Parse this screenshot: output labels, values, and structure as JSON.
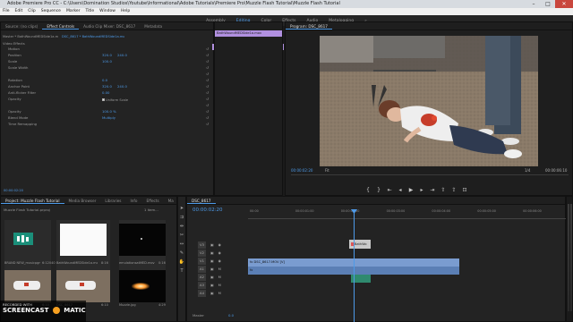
{
  "window": {
    "title": "Adobe Premiere Pro CC - C:\\Users\\Domination Studios\\Youtube\\Informational\\Adobe Tutorials\\Premiere Pro\\Muzzle Flash Tutorial\\Muzzle Flash Tutorial",
    "minimize": "–",
    "maximize": "□",
    "close": "✕"
  },
  "menu": [
    "File",
    "Edit",
    "Clip",
    "Sequence",
    "Marker",
    "Title",
    "Window",
    "Help"
  ],
  "workspaces": {
    "items": [
      "Assembly",
      "Editing",
      "Color",
      "Effects",
      "Audio",
      "Metalogging"
    ],
    "active": "Editing",
    "overflow": "»"
  },
  "effect_controls": {
    "tabs": [
      "Source: (no clips)",
      "Effect Controls",
      "Audio Clip Mixer: DSC_8617",
      "Metadata"
    ],
    "active_tab": "Effect Controls",
    "master_label": "Master * BathWoundMEDSide1a.mov",
    "clip_label": "DSC_8617 * BathWoundMEDSide1a.mov",
    "section_video_effects": "Video Effects",
    "clip_name_in_mini_timeline": "BathWoundMEDSide1a.mov",
    "rows": [
      {
        "label": "Motion",
        "v1": "",
        "v2": ""
      },
      {
        "label": "Position",
        "v1": "320.0",
        "v2": "240.0"
      },
      {
        "label": "Scale",
        "v1": "100.0",
        "v2": ""
      },
      {
        "label": "Scale Width",
        "v1": "",
        "v2": ""
      },
      {
        "label": "",
        "v1": "",
        "v2": ""
      },
      {
        "label": "Rotation",
        "v1": "0.0",
        "v2": ""
      },
      {
        "label": "Anchor Point",
        "v1": "320.0",
        "v2": "240.0"
      },
      {
        "label": "Anti-flicker Filter",
        "v1": "0.00",
        "v2": ""
      },
      {
        "label": "Opacity",
        "v1": "",
        "v2": ""
      },
      {
        "label": "",
        "v1": "",
        "v2": ""
      },
      {
        "label": "Opacity",
        "v1": "100.0 %",
        "v2": ""
      },
      {
        "label": "Blend Mode",
        "v1": "Multiply",
        "v2": ""
      },
      {
        "label": "Time Remapping",
        "v1": "",
        "v2": ""
      }
    ],
    "uniform_scale": "Uniform Scale",
    "timecode": "00:00:02:20"
  },
  "program_monitor": {
    "title": "Program: DSC_8617",
    "timecode": "00:00:02:20",
    "fit": "Fit",
    "page": "1/4",
    "duration": "00:00:06:10"
  },
  "project": {
    "tabs": [
      "Project: Muzzle Flash Tutorial",
      "Media Browser",
      "Libraries",
      "Info",
      "Effects",
      "Ma"
    ],
    "active_tab": "Project: Muzzle Flash Tutorial",
    "path": "Muzzle Flash Tutorial.prproj",
    "item_count": "1 item...",
    "items": [
      {
        "name": "BRAND NEW_musicpgm20L...",
        "dur": "6:12040"
      },
      {
        "name": "BathWoundMEDSide1a.mov",
        "dur": "8:16"
      },
      {
        "name": "emulationsatMED.mov",
        "dur": "0:16"
      },
      {
        "name": "DSC_8617",
        "dur": "6:10"
      },
      {
        "name": "DSC_8617",
        "dur": "6:10"
      },
      {
        "name": "Muzzle.jpg",
        "dur": "4:29"
      }
    ]
  },
  "timeline": {
    "tab": "DSC_8617",
    "timecode": "00:00:02:20",
    "ruler": [
      "00:00",
      "00:00:01:00",
      "00:00:02:00",
      "00:00:03:00",
      "00:00:04:00",
      "00:00:05:00",
      "00:00:06:00"
    ],
    "video_tracks": [
      "V3",
      "V2",
      "V1"
    ],
    "audio_tracks": [
      "A1",
      "A2",
      "A3",
      "A4"
    ],
    "master": "Master",
    "master_value": "0.0",
    "clips": {
      "v2_clip": "BathWo",
      "v1_clip": "fx DSC_8617.MOV [V]",
      "a1_clip": "fx"
    }
  },
  "watermark": {
    "line1": "RECORDED WITH",
    "line2": "SCREENCAST",
    "line3": "MATIC"
  },
  "colors": {
    "accent": "#4d9ae8",
    "video_clip": "#7a9cd0",
    "audio_clip": "#3fa58a",
    "v2_clip": "#c9c9c9",
    "playhead": "#4d9ae8"
  }
}
